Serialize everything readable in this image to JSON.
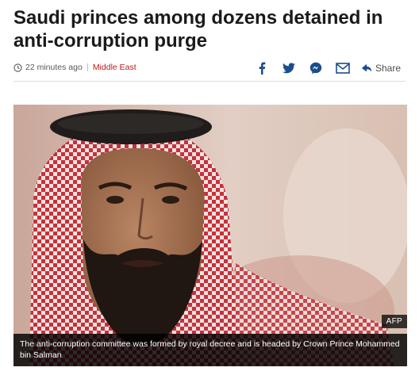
{
  "article": {
    "headline": "Saudi princes among dozens detained in anti-corruption purge",
    "timestamp": "22 minutes ago",
    "category": "Middle East"
  },
  "share": {
    "icons": [
      "facebook-icon",
      "twitter-icon",
      "messenger-icon",
      "email-icon",
      "share-icon"
    ],
    "label": "Share"
  },
  "figure": {
    "credit": "AFP",
    "caption": "The anti-corruption committee was formed by royal decree and is headed by Crown Prince Mohammed bin Salman"
  },
  "colors": {
    "category": "#bb1919",
    "share_icon": "#1a4e8c",
    "caption_bg": "#000000"
  }
}
